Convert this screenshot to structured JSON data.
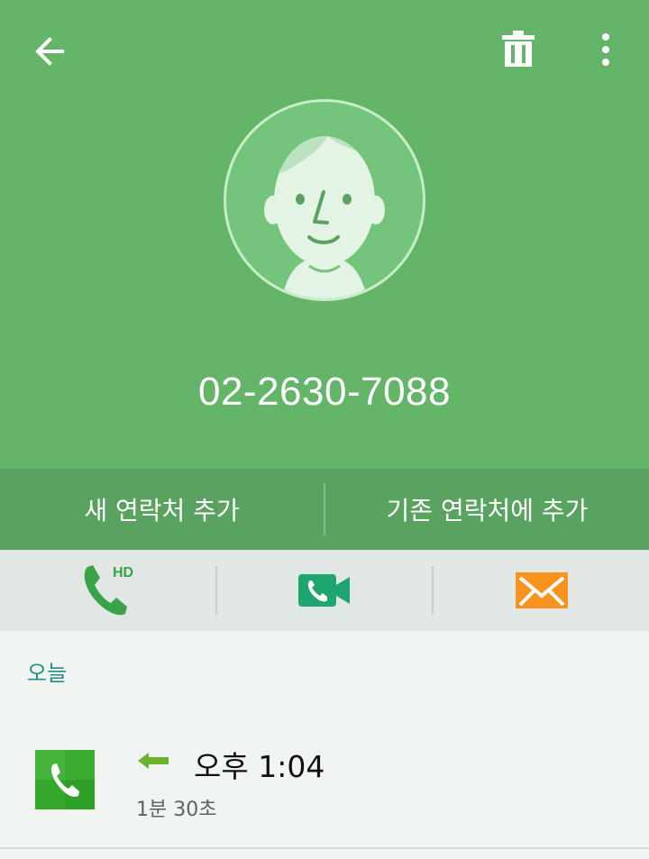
{
  "contact": {
    "phone_number": "02-2630-7088"
  },
  "toolbar": {
    "back_icon": "arrow-left-icon",
    "delete_icon": "trash-icon",
    "more_icon": "more-vertical-icon"
  },
  "actions": {
    "new_contact": "새 연락처 추가",
    "existing_contact": "기존 연락처에 추가"
  },
  "communication": {
    "voice_call_badge": "HD",
    "voice_icon": "phone-hd-icon",
    "video_icon": "video-call-icon",
    "message_icon": "message-envelope-icon"
  },
  "log": {
    "date_label": "오늘",
    "entries": [
      {
        "direction": "incoming",
        "time": "오후 1:04",
        "duration": "1분 30초"
      }
    ]
  },
  "colors": {
    "header": "#64b469",
    "action_bar": "#5aa25f",
    "comm_bar": "#e1e7e5",
    "voice_green": "#3aa34a",
    "video_green": "#1fa66e",
    "message_orange": "#f7931e",
    "date_teal": "#248b86"
  }
}
